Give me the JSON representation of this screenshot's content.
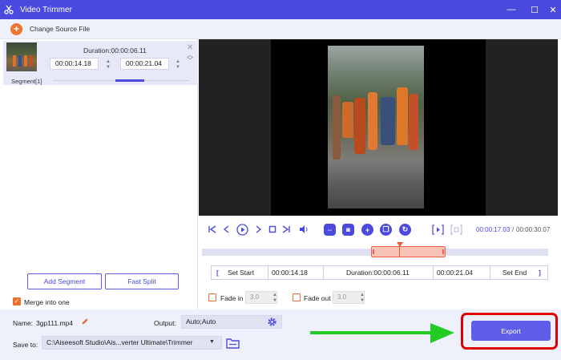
{
  "window": {
    "title": "Video Trimmer",
    "minimize_glyph": "—",
    "maximize_glyph": "☐",
    "close_glyph": "✕"
  },
  "toolbar": {
    "add_glyph": "+",
    "change_source_label": "Change Source File"
  },
  "segment": {
    "duration": "Duration:00:00:06.11",
    "start": "00:00:14.18",
    "end": "00:00:21.04",
    "label": "Segment[1]",
    "close_glyph": "✕",
    "up_glyph": "︿",
    "down_glyph": "﹀",
    "progress": 0.35
  },
  "left_actions": {
    "add_segment": "Add Segment",
    "fast_split": "Fast Split",
    "merge_label": "Merge into one",
    "merge_checked": true,
    "check_glyph": "✓"
  },
  "player": {
    "current_time": "00:00:17.03",
    "separator": "/",
    "total_time": "00:00:30.07",
    "icons": [
      "skip-start-icon",
      "prev-frame-icon",
      "play-icon",
      "next-frame-icon",
      "stop-icon",
      "skip-end-icon",
      "volume-icon",
      "split-icon",
      "snapshot-icon",
      "add-icon",
      "copy-icon",
      "reset-icon",
      "set-in-icon",
      "set-out-icon"
    ]
  },
  "trim": {
    "set_start_bracket": "[",
    "set_start": "Set Start",
    "start": "00:00:14.18",
    "duration": "Duration:00:00:06.11",
    "end": "00:00:21.04",
    "set_end": "Set End",
    "set_end_bracket": "]"
  },
  "fade": {
    "fade_in_label": "Fade in",
    "fade_in_value": "3.0",
    "fade_out_label": "Fade out",
    "fade_out_value": "3.0"
  },
  "bottom": {
    "name_label": "Name:",
    "name_value": "3gp111.mp4",
    "output_label": "Output:",
    "output_value": "Auto;Auto",
    "save_label": "Save to:",
    "save_value": "C:\\Aiseesoft Studio\\Ais...verter Ultimate\\Trimmer",
    "export_label": "Export"
  },
  "colors": {
    "accent": "#4a4adf",
    "orange": "#f07030",
    "highlight": "#e00000",
    "arrow": "#22cc22"
  }
}
